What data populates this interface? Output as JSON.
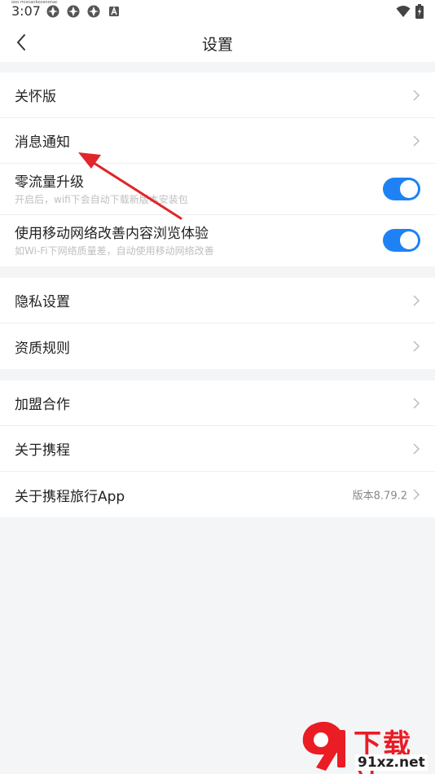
{
  "status_bar": {
    "time": "3:07",
    "tiny_text": "ooo rrcocanbocenonac",
    "left_icons": [
      "app-notification-icon",
      "app-notification-icon",
      "app-notification-icon",
      "app-a-icon"
    ],
    "right_icons": [
      "wifi-icon",
      "battery-charging-icon"
    ]
  },
  "header": {
    "title": "设置",
    "back_icon": "chevron-left-icon"
  },
  "groups": [
    {
      "items": [
        {
          "label": "关怀版",
          "type": "link"
        },
        {
          "label": "消息通知",
          "type": "link"
        },
        {
          "label": "零流量升级",
          "subtitle": "开启后，wifi下会自动下载新版本安装包",
          "type": "toggle",
          "on": true
        },
        {
          "label": "使用移动网络改善内容浏览体验",
          "subtitle": "如Wi-Fi下网络质量差，自动使用移动网络改善",
          "type": "toggle",
          "on": true
        }
      ]
    },
    {
      "items": [
        {
          "label": "隐私设置",
          "type": "link"
        },
        {
          "label": "资质规则",
          "type": "link"
        }
      ]
    },
    {
      "items": [
        {
          "label": "加盟合作",
          "type": "link"
        },
        {
          "label": "关于携程",
          "type": "link"
        },
        {
          "label": "关于携程旅行App",
          "value": "版本8.79.2",
          "type": "link"
        }
      ]
    }
  ],
  "colors": {
    "toggle_on": "#1e82f5",
    "background": "#f4f5f7",
    "annotation_arrow": "#e0252b",
    "watermark_red": "#ea1c24"
  },
  "watermark": {
    "title": "下载站",
    "url": "91xz.net"
  }
}
